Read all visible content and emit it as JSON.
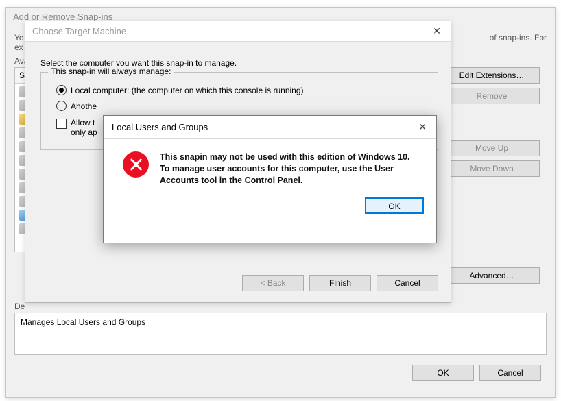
{
  "add_remove": {
    "title": "Add or Remove Snap-ins",
    "intro_suffix": "of snap-ins. For",
    "available_label": "Ava",
    "snapins_header": "S",
    "description_label": "De",
    "description_text": "Manages Local Users and Groups",
    "buttons": {
      "edit_ext": "Edit Extensions…",
      "remove": "Remove",
      "move_up": "Move Up",
      "move_down": "Move Down",
      "advanced": "Advanced…",
      "ok": "OK",
      "cancel": "Cancel"
    }
  },
  "wizard": {
    "title": "Choose Target Machine",
    "you_prefix": "Yo",
    "ext_prefix": "ex",
    "select_text": "Select the computer you want this snap-in to manage.",
    "group_legend": "This snap-in will always manage:",
    "radio_local": "Local computer:  (the computer on which this console is running)",
    "radio_another": "Anothe",
    "allow_line1": "Allow t",
    "allow_line2": "only ap",
    "buttons": {
      "back": "< Back",
      "finish": "Finish",
      "cancel": "Cancel"
    }
  },
  "error": {
    "title": "Local Users and Groups",
    "message": "This snapin may not be used with this edition of Windows 10. To manage user accounts for this computer, use the User Accounts tool in the Control Panel.",
    "ok": "OK"
  }
}
